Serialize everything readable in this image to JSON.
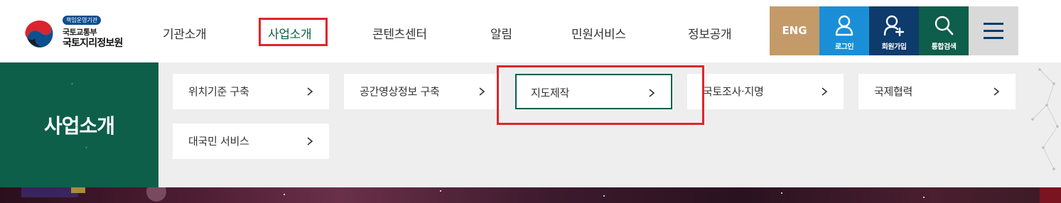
{
  "logo": {
    "badge": "책임운영기관",
    "ministry": "국토교통부",
    "agency": "국토지리정보원"
  },
  "gnb": {
    "items": [
      {
        "label": "기관소개"
      },
      {
        "label": "사업소개",
        "active": true
      },
      {
        "label": "콘텐츠센터"
      },
      {
        "label": "알림"
      },
      {
        "label": "민원서비스"
      },
      {
        "label": "정보공개"
      }
    ]
  },
  "utility": {
    "eng": "ENG",
    "login": "로그인",
    "join": "회원가입",
    "search": "통합검색",
    "menu_icon": "hamburger-icon"
  },
  "mega_menu": {
    "title": "사업소개",
    "items": [
      {
        "label": "위치기준 구축"
      },
      {
        "label": "공간영상정보 구축"
      },
      {
        "label": "지도제작",
        "active": true
      },
      {
        "label": "국토조사·지명"
      },
      {
        "label": "국제협력"
      },
      {
        "label": "대국민 서비스"
      }
    ]
  },
  "colors": {
    "brand_green": "#0d5f4a",
    "eng_bg": "#c49b68",
    "login_bg": "#1a8fd8",
    "join_bg": "#0c3b6c",
    "search_bg": "#0d5e4a",
    "menu_bg": "#d9d9d9",
    "highlight": "#e0252b"
  }
}
